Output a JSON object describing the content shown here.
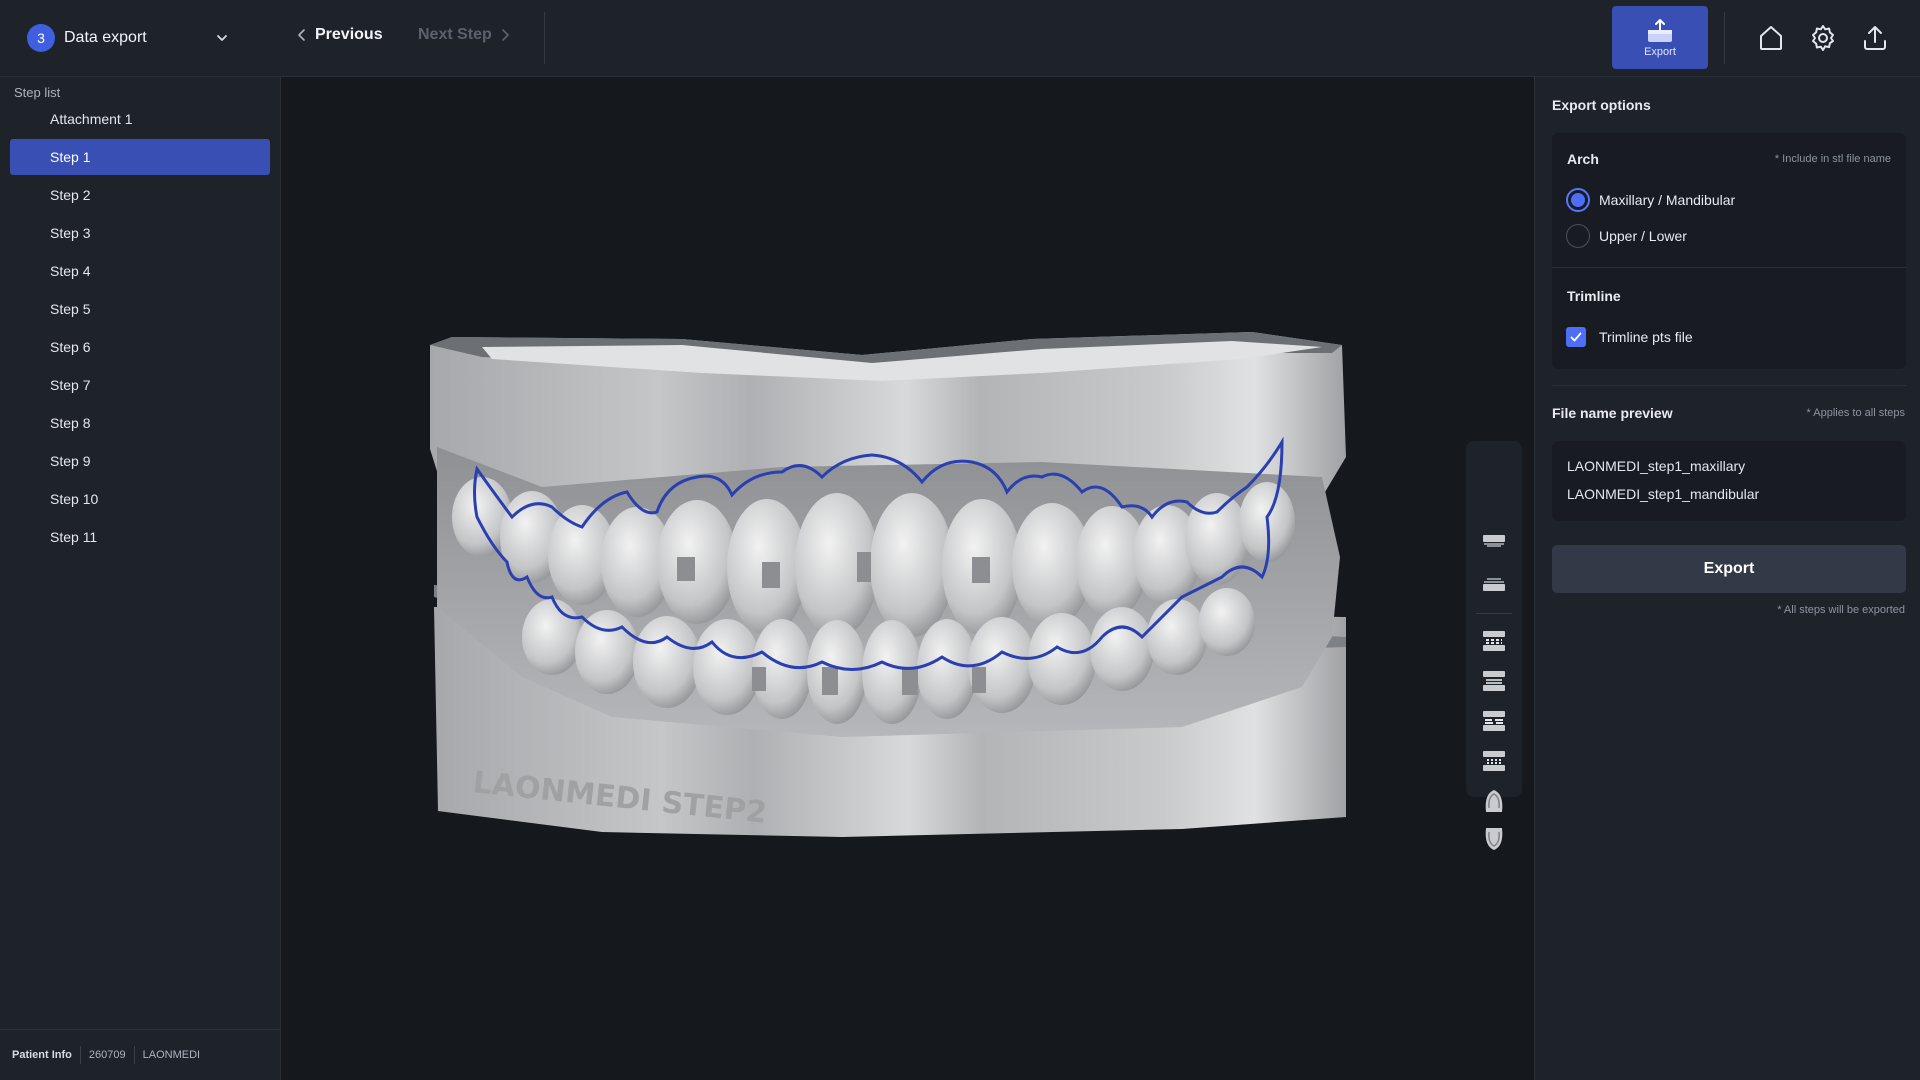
{
  "header": {
    "stage_number": "3",
    "stage_label": "Data export",
    "prev_label": "Previous",
    "next_label": "Next Step",
    "export_label": "Export"
  },
  "sidebar": {
    "title": "Step list",
    "items": [
      {
        "label": "Attachment 1",
        "active": false
      },
      {
        "label": "Step 1",
        "active": true
      },
      {
        "label": "Step 2",
        "active": false
      },
      {
        "label": "Step 3",
        "active": false
      },
      {
        "label": "Step 4",
        "active": false
      },
      {
        "label": "Step 5",
        "active": false
      },
      {
        "label": "Step 6",
        "active": false
      },
      {
        "label": "Step 7",
        "active": false
      },
      {
        "label": "Step 8",
        "active": false
      },
      {
        "label": "Step 9",
        "active": false
      },
      {
        "label": "Step 10",
        "active": false
      },
      {
        "label": "Step 11",
        "active": false
      }
    ],
    "patient": {
      "label": "Patient Info",
      "id": "260709",
      "name": "LAONMEDI"
    }
  },
  "viewport": {
    "model_engraving": "LAONMEDI STEP2",
    "trimline_color": "#2a3fb0"
  },
  "export_panel": {
    "title": "Export options",
    "arch": {
      "heading": "Arch",
      "note": "* Include in stl file name",
      "options": [
        {
          "label": "Maxillary / Mandibular",
          "selected": true
        },
        {
          "label": "Upper / Lower",
          "selected": false
        }
      ]
    },
    "trimline": {
      "heading": "Trimline",
      "checkbox_label": "Trimline pts file",
      "checked": true
    },
    "file_name_preview": {
      "title": "File name preview",
      "note": "* Applies to all steps",
      "lines": [
        "LAONMEDI_step1_maxillary",
        "LAONMEDI_step1_mandibular"
      ]
    },
    "export_button": "Export",
    "footer_note": "* All steps will be exported"
  },
  "colors": {
    "accent": "#3a4fb4",
    "radio_on": "#4e6ef6",
    "panel_bg": "#1e232a",
    "viewport_bg": "#15181d"
  }
}
